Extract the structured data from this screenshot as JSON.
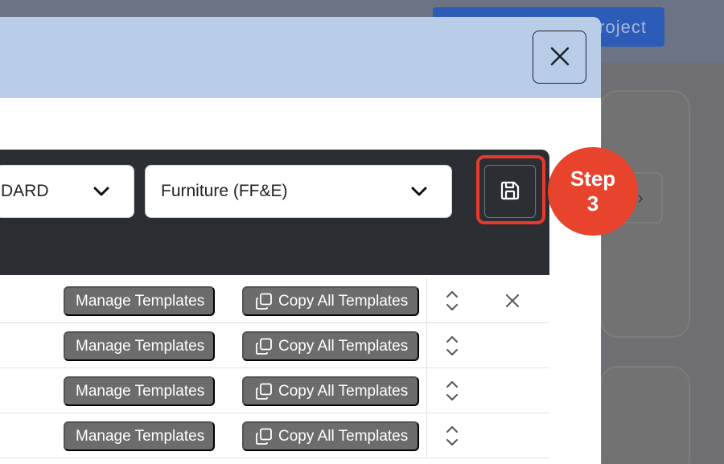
{
  "background": {
    "header_button_label": "roject",
    "mini_card_glyph": "›"
  },
  "modal": {
    "close_icon": "close-icon",
    "toolbar": {
      "select_1_value": "DARD",
      "select_2_value": "Furniture (FF&E)",
      "save_icon": "save-icon"
    },
    "rows": [
      {
        "manage_label": "Manage Templates",
        "copy_label": "Copy All Templates",
        "has_delete": true
      },
      {
        "manage_label": "Manage Templates",
        "copy_label": "Copy All Templates",
        "has_delete": false
      },
      {
        "manage_label": "Manage Templates",
        "copy_label": "Copy All Templates",
        "has_delete": false
      },
      {
        "manage_label": "Manage Templates",
        "copy_label": "Copy All Templates",
        "has_delete": false
      }
    ]
  },
  "step_badge": {
    "line1": "Step",
    "line2": "3"
  },
  "colors": {
    "accent_red": "#e8432d",
    "header_blue": "#b9cde8",
    "toolbar_dark": "#2b2f33",
    "tag_gray": "#6c6c6c"
  }
}
